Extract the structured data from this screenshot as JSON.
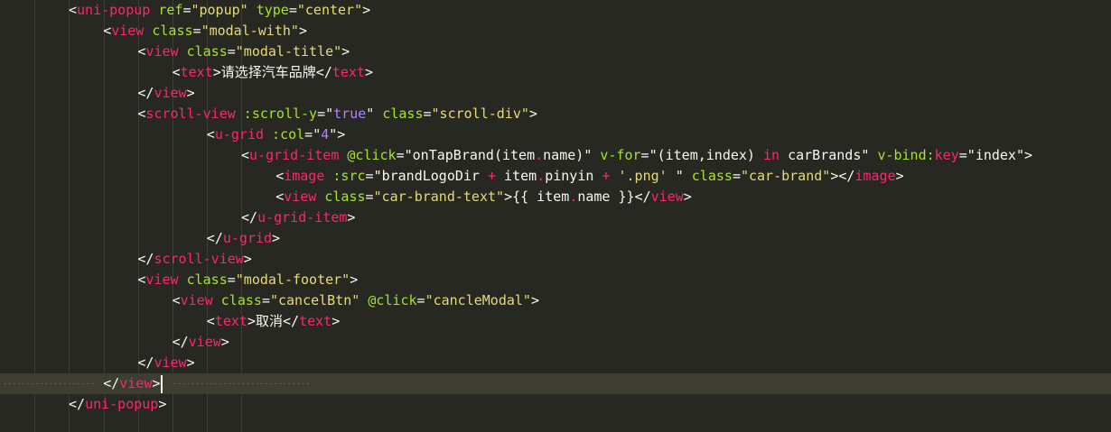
{
  "editor": {
    "theme": "monokai",
    "colors": {
      "background": "#272822",
      "tag": "#f92672",
      "attribute": "#a6e22e",
      "string": "#e6db74",
      "text": "#f8f8f2",
      "constant": "#ae81ff",
      "current_line": "#3e3d32"
    },
    "lines": [
      {
        "indent": 0,
        "tokens": [
          [
            "p",
            "<"
          ],
          [
            "tag",
            "uni-popup"
          ],
          [
            "t",
            " "
          ],
          [
            "attr",
            "ref"
          ],
          [
            "p",
            "="
          ],
          [
            "s",
            "\"popup\""
          ],
          [
            "t",
            " "
          ],
          [
            "attr",
            "type"
          ],
          [
            "p",
            "="
          ],
          [
            "s",
            "\"center\""
          ],
          [
            "p",
            ">"
          ]
        ]
      },
      {
        "indent": 1,
        "tokens": [
          [
            "p",
            "<"
          ],
          [
            "tag",
            "view"
          ],
          [
            "t",
            " "
          ],
          [
            "attr",
            "class"
          ],
          [
            "p",
            "="
          ],
          [
            "s",
            "\"modal-with\""
          ],
          [
            "p",
            ">"
          ]
        ]
      },
      {
        "indent": 2,
        "tokens": [
          [
            "p",
            "<"
          ],
          [
            "tag",
            "view"
          ],
          [
            "t",
            " "
          ],
          [
            "attr",
            "class"
          ],
          [
            "p",
            "="
          ],
          [
            "s",
            "\"modal-title\""
          ],
          [
            "p",
            ">"
          ]
        ]
      },
      {
        "indent": 3,
        "tokens": [
          [
            "p",
            "<"
          ],
          [
            "tag",
            "text"
          ],
          [
            "p",
            ">"
          ],
          [
            "t",
            "请选择汽车品牌"
          ],
          [
            "p",
            "</"
          ],
          [
            "tag",
            "text"
          ],
          [
            "p",
            ">"
          ]
        ]
      },
      {
        "indent": 2,
        "tokens": [
          [
            "p",
            "</"
          ],
          [
            "tag",
            "view"
          ],
          [
            "p",
            ">"
          ]
        ]
      },
      {
        "indent": 2,
        "tokens": [
          [
            "p",
            "<"
          ],
          [
            "tag",
            "scroll-view"
          ],
          [
            "t",
            " "
          ],
          [
            "attr",
            ":scroll-y"
          ],
          [
            "p",
            "="
          ],
          [
            "p",
            "\""
          ],
          [
            "k",
            "true"
          ],
          [
            "p",
            "\""
          ],
          [
            "t",
            " "
          ],
          [
            "attr",
            "class"
          ],
          [
            "p",
            "="
          ],
          [
            "s",
            "\"scroll-div\""
          ],
          [
            "p",
            ">"
          ]
        ]
      },
      {
        "indent": 4,
        "tokens": [
          [
            "p",
            "<"
          ],
          [
            "tag",
            "u-grid"
          ],
          [
            "t",
            " "
          ],
          [
            "attr",
            ":col"
          ],
          [
            "p",
            "="
          ],
          [
            "p",
            "\""
          ],
          [
            "k",
            "4"
          ],
          [
            "p",
            "\""
          ],
          [
            "p",
            ">"
          ]
        ]
      },
      {
        "indent": 5,
        "tokens": [
          [
            "p",
            "<"
          ],
          [
            "tag",
            "u-grid-item"
          ],
          [
            "t",
            " "
          ],
          [
            "attr",
            "@click"
          ],
          [
            "p",
            "="
          ],
          [
            "p",
            "\""
          ],
          [
            "t",
            "onTapBrand(item"
          ],
          [
            "o",
            "."
          ],
          [
            "t",
            "name)"
          ],
          [
            "p",
            "\""
          ],
          [
            "t",
            " "
          ],
          [
            "attr",
            "v-for"
          ],
          [
            "p",
            "="
          ],
          [
            "p",
            "\""
          ],
          [
            "t",
            "(item,index) "
          ],
          [
            "o",
            "in"
          ],
          [
            "t",
            " carBrands"
          ],
          [
            "p",
            "\""
          ],
          [
            "t",
            " "
          ],
          [
            "attr",
            "v-bind:"
          ],
          [
            "tag",
            "key"
          ],
          [
            "p",
            "="
          ],
          [
            "p",
            "\""
          ],
          [
            "t",
            "index"
          ],
          [
            "p",
            "\""
          ],
          [
            "p",
            ">"
          ]
        ]
      },
      {
        "indent": 6,
        "tokens": [
          [
            "p",
            "<"
          ],
          [
            "tag",
            "image"
          ],
          [
            "t",
            " "
          ],
          [
            "attr",
            ":src"
          ],
          [
            "p",
            "="
          ],
          [
            "p",
            "\""
          ],
          [
            "t",
            "brandLogoDir "
          ],
          [
            "o",
            "+"
          ],
          [
            "t",
            " item"
          ],
          [
            "o",
            "."
          ],
          [
            "t",
            "pinyin "
          ],
          [
            "o",
            "+"
          ],
          [
            "t",
            " "
          ],
          [
            "s",
            "'.png'"
          ],
          [
            "t",
            " "
          ],
          [
            "p",
            "\""
          ],
          [
            "t",
            " "
          ],
          [
            "attr",
            "class"
          ],
          [
            "p",
            "="
          ],
          [
            "s",
            "\"car-brand\""
          ],
          [
            "p",
            "></"
          ],
          [
            "tag",
            "image"
          ],
          [
            "p",
            ">"
          ]
        ]
      },
      {
        "indent": 6,
        "tokens": [
          [
            "p",
            "<"
          ],
          [
            "tag",
            "view"
          ],
          [
            "t",
            " "
          ],
          [
            "attr",
            "class"
          ],
          [
            "p",
            "="
          ],
          [
            "s",
            "\"car-brand-text\""
          ],
          [
            "p",
            ">"
          ],
          [
            "t",
            "{{ item"
          ],
          [
            "o",
            "."
          ],
          [
            "t",
            "name }}"
          ],
          [
            "p",
            "</"
          ],
          [
            "tag",
            "view"
          ],
          [
            "p",
            ">"
          ]
        ]
      },
      {
        "indent": 5,
        "tokens": [
          [
            "p",
            "</"
          ],
          [
            "tag",
            "u-grid-item"
          ],
          [
            "p",
            ">"
          ]
        ]
      },
      {
        "indent": 4,
        "tokens": [
          [
            "p",
            "</"
          ],
          [
            "tag",
            "u-grid"
          ],
          [
            "p",
            ">"
          ]
        ]
      },
      {
        "indent": 2,
        "tokens": [
          [
            "p",
            "</"
          ],
          [
            "tag",
            "scroll-view"
          ],
          [
            "p",
            ">"
          ]
        ]
      },
      {
        "indent": 2,
        "tokens": [
          [
            "p",
            "<"
          ],
          [
            "tag",
            "view"
          ],
          [
            "t",
            " "
          ],
          [
            "attr",
            "class"
          ],
          [
            "p",
            "="
          ],
          [
            "s",
            "\"modal-footer\""
          ],
          [
            "p",
            ">"
          ]
        ]
      },
      {
        "indent": 3,
        "tokens": [
          [
            "p",
            "<"
          ],
          [
            "tag",
            "view"
          ],
          [
            "t",
            " "
          ],
          [
            "attr",
            "class"
          ],
          [
            "p",
            "="
          ],
          [
            "s",
            "\"cancelBtn\""
          ],
          [
            "t",
            " "
          ],
          [
            "attr",
            "@click"
          ],
          [
            "p",
            "="
          ],
          [
            "s",
            "\"cancleModal\""
          ],
          [
            "p",
            ">"
          ]
        ]
      },
      {
        "indent": 4,
        "tokens": [
          [
            "p",
            "<"
          ],
          [
            "tag",
            "text"
          ],
          [
            "p",
            ">"
          ],
          [
            "t",
            "取消"
          ],
          [
            "p",
            "</"
          ],
          [
            "tag",
            "text"
          ],
          [
            "p",
            ">"
          ]
        ]
      },
      {
        "indent": 3,
        "tokens": [
          [
            "p",
            "</"
          ],
          [
            "tag",
            "view"
          ],
          [
            "p",
            ">"
          ]
        ]
      },
      {
        "indent": 2,
        "tokens": [
          [
            "p",
            "</"
          ],
          [
            "tag",
            "view"
          ],
          [
            "p",
            ">"
          ]
        ]
      },
      {
        "indent": 1,
        "current": true,
        "tokens": [
          [
            "p",
            "</"
          ],
          [
            "tag",
            "view"
          ],
          [
            "p",
            ">"
          ]
        ]
      },
      {
        "indent": 0,
        "tokens": [
          [
            "p",
            "</"
          ],
          [
            "tag",
            "uni-popup"
          ],
          [
            "p",
            ">"
          ]
        ]
      }
    ]
  }
}
